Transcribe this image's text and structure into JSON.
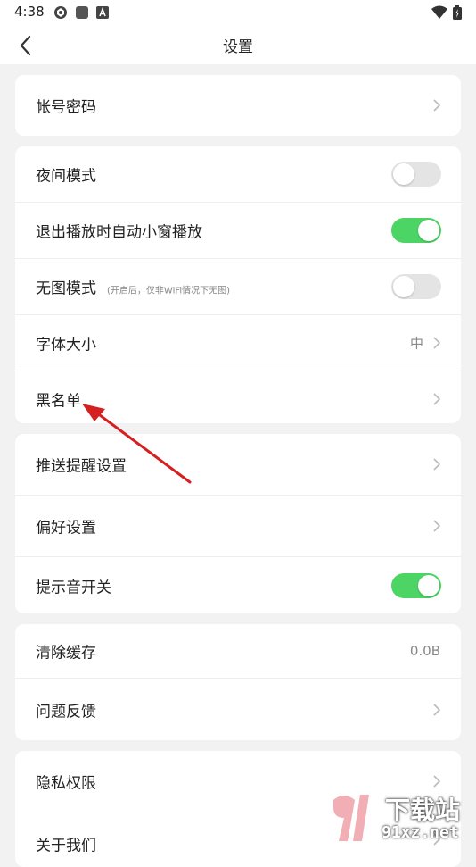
{
  "status_bar": {
    "time": "4:38",
    "icons": [
      "app-icon",
      "app-icon",
      "a-icon",
      "wifi-icon",
      "battery-icon"
    ]
  },
  "header": {
    "title": "设置",
    "back_icon": "chevron-left-icon"
  },
  "cards": [
    {
      "rows": [
        {
          "label": "帐号密码",
          "accessory": "chevron"
        }
      ]
    },
    {
      "rows": [
        {
          "label": "夜间模式",
          "accessory": "toggle",
          "toggle_on": false
        },
        {
          "label": "退出播放时自动小窗播放",
          "accessory": "toggle",
          "toggle_on": true
        },
        {
          "label": "无图模式",
          "hint": "(开启后，仅非WiFi情况下无图)",
          "accessory": "toggle",
          "toggle_on": false
        },
        {
          "label": "字体大小",
          "value": "中",
          "accessory": "chevron"
        },
        {
          "label": "黑名单",
          "accessory": "chevron"
        }
      ]
    },
    {
      "rows": [
        {
          "label": "推送提醒设置",
          "accessory": "chevron"
        },
        {
          "label": "偏好设置",
          "accessory": "chevron"
        },
        {
          "label": "提示音开关",
          "accessory": "toggle",
          "toggle_on": true
        }
      ]
    },
    {
      "rows": [
        {
          "label": "清除缓存",
          "value": "0.0B"
        },
        {
          "label": "问题反馈",
          "accessory": "chevron"
        }
      ]
    },
    {
      "rows": [
        {
          "label": "隐私权限",
          "accessory": "chevron"
        },
        {
          "label": "关于我们",
          "accessory": "chevron"
        }
      ]
    }
  ],
  "colors": {
    "toggle_on": "#4cd464",
    "toggle_off": "#e4e4e4",
    "annotation_arrow": "#d42020",
    "background": "#f2f2f2"
  },
  "watermark": {
    "text_top": "下载站",
    "text_bottom": "91xz.net"
  }
}
